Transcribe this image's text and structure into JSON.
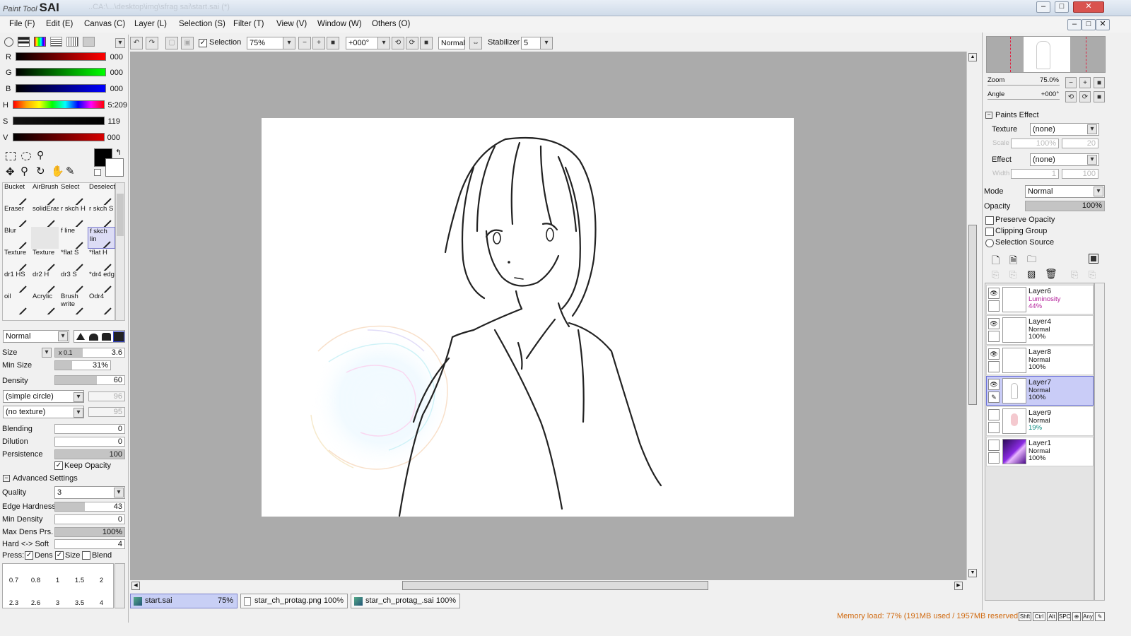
{
  "titlebar": {
    "logo_small": "Paint Tool",
    "logo_big": "SAI",
    "title": "..CA:\\...\\desktop\\img\\sfrag sai\\start.sai (*)",
    "buttons": [
      "–",
      "□",
      "✕"
    ]
  },
  "menu": [
    "File (F)",
    "Edit (E)",
    "Canvas (C)",
    "Layer (L)",
    "Selection (S)",
    "Filter (T)",
    "View (V)",
    "Window (W)",
    "Others (O)"
  ],
  "toolbar": {
    "selection_label": "Selection",
    "selection_checked": true,
    "zoom": "75%",
    "angle": "+000°",
    "blend": "Normal",
    "stabilizer_label": "Stabilizer",
    "stabilizer": "5"
  },
  "colors": {
    "r_label": "R",
    "r": "000",
    "g_label": "G",
    "g": "000",
    "b_label": "B",
    "b": "000",
    "h_label": "H",
    "h": "5:209",
    "s_label": "S",
    "s": "119",
    "v_label": "V",
    "v": "000",
    "primary": "#000000",
    "secondary": "#ffffff"
  },
  "tools": [
    {
      "name": "Bucket"
    },
    {
      "name": "AirBrush"
    },
    {
      "name": "Select"
    },
    {
      "name": "Deselect"
    },
    {
      "name": "Eraser"
    },
    {
      "name": "solidEras"
    },
    {
      "name": "r skch H"
    },
    {
      "name": "r skch S"
    },
    {
      "name": "Blur"
    },
    {
      "name": ""
    },
    {
      "name": "f line"
    },
    {
      "name": "f skch lin"
    },
    {
      "name": "Texture"
    },
    {
      "name": "Texture"
    },
    {
      "name": "*flat S"
    },
    {
      "name": "*flat H"
    },
    {
      "name": "dr1 HS"
    },
    {
      "name": "dr2 H"
    },
    {
      "name": "dr3 S"
    },
    {
      "name": "*dr4 edg"
    },
    {
      "name": "oil"
    },
    {
      "name": "Acrylic"
    },
    {
      "name": "Brush write"
    },
    {
      "name": "Odr4"
    }
  ],
  "brush": {
    "mode": "Normal",
    "size_label": "Size",
    "size_mult": "x 0.1",
    "size": "3.6",
    "minsize_label": "Min Size",
    "minsize": "31%",
    "minsize_pct": 31,
    "density_label": "Density",
    "density": "60",
    "density_pct": 60,
    "shape": "(simple circle)",
    "shape_val": "96",
    "texture": "(no texture)",
    "texture_val": "95",
    "blending_label": "Blending",
    "blending": "0",
    "dilution_label": "Dilution",
    "dilution": "0",
    "persistence_label": "Persistence",
    "persistence": "100",
    "persistence_pct": 100,
    "keep_opacity": "Keep Opacity",
    "advanced": "Advanced Settings",
    "quality_label": "Quality",
    "quality": "3",
    "edge_label": "Edge Hardness",
    "edge": "43",
    "edge_pct": 43,
    "mindens_label": "Min Density",
    "mindens": "0",
    "maxdens_label": "Max Dens Prs.",
    "maxdens": "100%",
    "maxdens_pct": 100,
    "hardsoft_label": "Hard <-> Soft",
    "hardsoft": "4",
    "press_label": "Press:",
    "dens_label": "Dens",
    "size_cb": "Size",
    "blend_cb": "Blend"
  },
  "presets": [
    "0.7",
    "0.8",
    "1",
    "1.5",
    "2",
    "2.3",
    "2.6",
    "3",
    "3.5",
    "4"
  ],
  "tabs": [
    {
      "name": "start.sai",
      "zoom": "75%"
    },
    {
      "name": "star_ch_protag.png",
      "zoom": "100%"
    },
    {
      "name": "star_ch_protag_.sai",
      "zoom": "100%"
    }
  ],
  "navigator": {
    "zoom_label": "Zoom",
    "zoom": "75.0%",
    "angle_label": "Angle",
    "angle": "+000°"
  },
  "paints_effect": {
    "title": "Paints Effect",
    "texture_label": "Texture",
    "texture": "(none)",
    "scale_label": "Scale",
    "scale": "100%",
    "scale_val": "20",
    "effect_label": "Effect",
    "effect": "(none)",
    "width_label": "Width",
    "width": "1",
    "width_val": "100"
  },
  "layer_props": {
    "mode_label": "Mode",
    "mode": "Normal",
    "opacity_label": "Opacity",
    "opacity": "100%",
    "preserve": "Preserve Opacity",
    "clipping": "Clipping Group",
    "selsource": "Selection Source"
  },
  "layers": [
    {
      "name": "Layer6",
      "mode": "Luminosity",
      "opacity": "44%",
      "visible": true
    },
    {
      "name": "Layer4",
      "mode": "Normal",
      "opacity": "100%",
      "visible": true
    },
    {
      "name": "Layer8",
      "mode": "Normal",
      "opacity": "100%",
      "visible": true
    },
    {
      "name": "Layer7",
      "mode": "Normal",
      "opacity": "100%",
      "visible": true
    },
    {
      "name": "Layer9",
      "mode": "Normal",
      "opacity": "19%",
      "visible": false
    },
    {
      "name": "Layer1",
      "mode": "Normal",
      "opacity": "100%",
      "visible": false
    }
  ],
  "status": {
    "memory": "Memory load: 77% (191MB used / 1957MB reserved)",
    "keys": [
      "Shft",
      "Ctrl",
      "Alt",
      "SPC",
      "⊕",
      "Any",
      "✎"
    ]
  }
}
